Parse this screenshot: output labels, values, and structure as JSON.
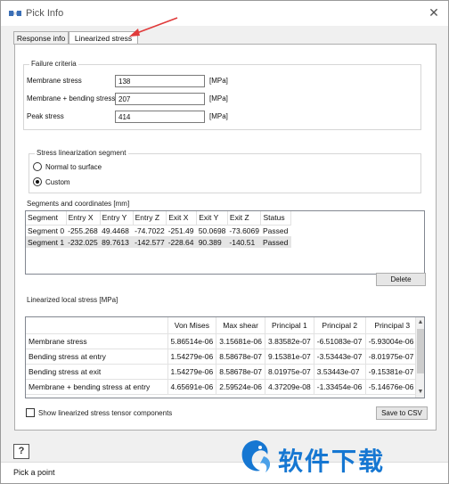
{
  "window": {
    "title": "Pick Info"
  },
  "tabs": [
    {
      "label": "Response info",
      "active": false
    },
    {
      "label": "Linearized stress",
      "active": true
    }
  ],
  "failure_criteria": {
    "title": "Failure criteria",
    "fields": [
      {
        "label": "Membrane stress",
        "value": "138",
        "unit": "[MPa]"
      },
      {
        "label": "Membrane + bending stress",
        "value": "207",
        "unit": "[MPa]"
      },
      {
        "label": "Peak stress",
        "value": "414",
        "unit": "[MPa]"
      }
    ]
  },
  "segment_options": {
    "title": "Stress linearization segment",
    "options": [
      {
        "label": "Normal to surface",
        "checked": false
      },
      {
        "label": "Custom",
        "checked": true
      }
    ]
  },
  "segments": {
    "title": "Segments and coordinates [mm]",
    "columns": [
      "Segment",
      "Entry X",
      "Entry Y",
      "Entry Z",
      "Exit X",
      "Exit Y",
      "Exit Z",
      "Status"
    ],
    "rows": [
      [
        "Segment 0",
        "-255.268",
        "49.4468",
        "-74.7022",
        "-251.49",
        "50.0698",
        "-73.6069",
        "Passed"
      ],
      [
        "Segment 1",
        "-232.025",
        "89.7613",
        "-142.577",
        "-228.64",
        "90.389",
        "-140.51",
        "Passed"
      ]
    ],
    "delete_label": "Delete"
  },
  "linearized": {
    "title": "Linearized local stress [MPa]",
    "columns": [
      "",
      "Von Mises",
      "Max shear",
      "Principal 1",
      "Principal 2",
      "Principal 3"
    ],
    "rows": [
      [
        "Membrane stress",
        "5.86514e-06",
        "3.15681e-06",
        "3.83582e-07",
        "-6.51083e-07",
        "-5.93004e-06"
      ],
      [
        "Bending stress at entry",
        "1.54279e-06",
        "8.58678e-07",
        "9.15381e-07",
        "-3.53443e-07",
        "-8.01975e-07"
      ],
      [
        "Bending stress at exit",
        "1.54279e-06",
        "8.58678e-07",
        "8.01975e-07",
        "3.53443e-07",
        "-9.15381e-07"
      ],
      [
        "Membrane + bending stress at entry",
        "4.65691e-06",
        "2.59524e-06",
        "4.37209e-08",
        "-1.33454e-06",
        "-5.14676e-06"
      ]
    ],
    "show_tensor_label": "Show linearized stress tensor components",
    "save_csv_label": "Save to CSV"
  },
  "help_label": "?",
  "status": "Pick a point",
  "watermark_text": "软件下载",
  "colors": {
    "accent": "#1677d2",
    "arrow": "#e03a3a"
  }
}
